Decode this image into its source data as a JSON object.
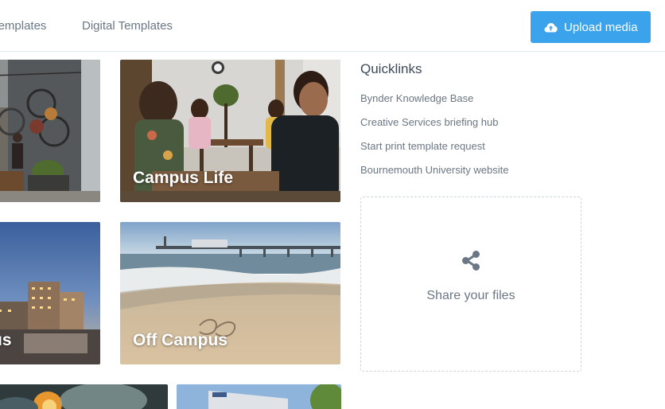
{
  "nav": {
    "items": [
      "t Templates",
      "Digital Templates"
    ],
    "upload_label": "Upload media"
  },
  "tiles": {
    "top_left": {
      "label": ""
    },
    "campus_life": {
      "label": "Campus Life"
    },
    "bottom_left": {
      "label": "us"
    },
    "off_campus": {
      "label": "Off Campus"
    }
  },
  "quicklinks": {
    "title": "Quicklinks",
    "items": [
      "Bynder Knowledge Base",
      "Creative Services briefing hub",
      "Start print template request",
      "Bournemouth University website"
    ]
  },
  "share": {
    "label": "Share your files"
  },
  "colors": {
    "accent": "#3aa3ec",
    "text": "#3d4a5c",
    "muted": "#6b7785"
  },
  "icons": {
    "upload": "cloud-upload-icon",
    "share": "share-icon"
  }
}
